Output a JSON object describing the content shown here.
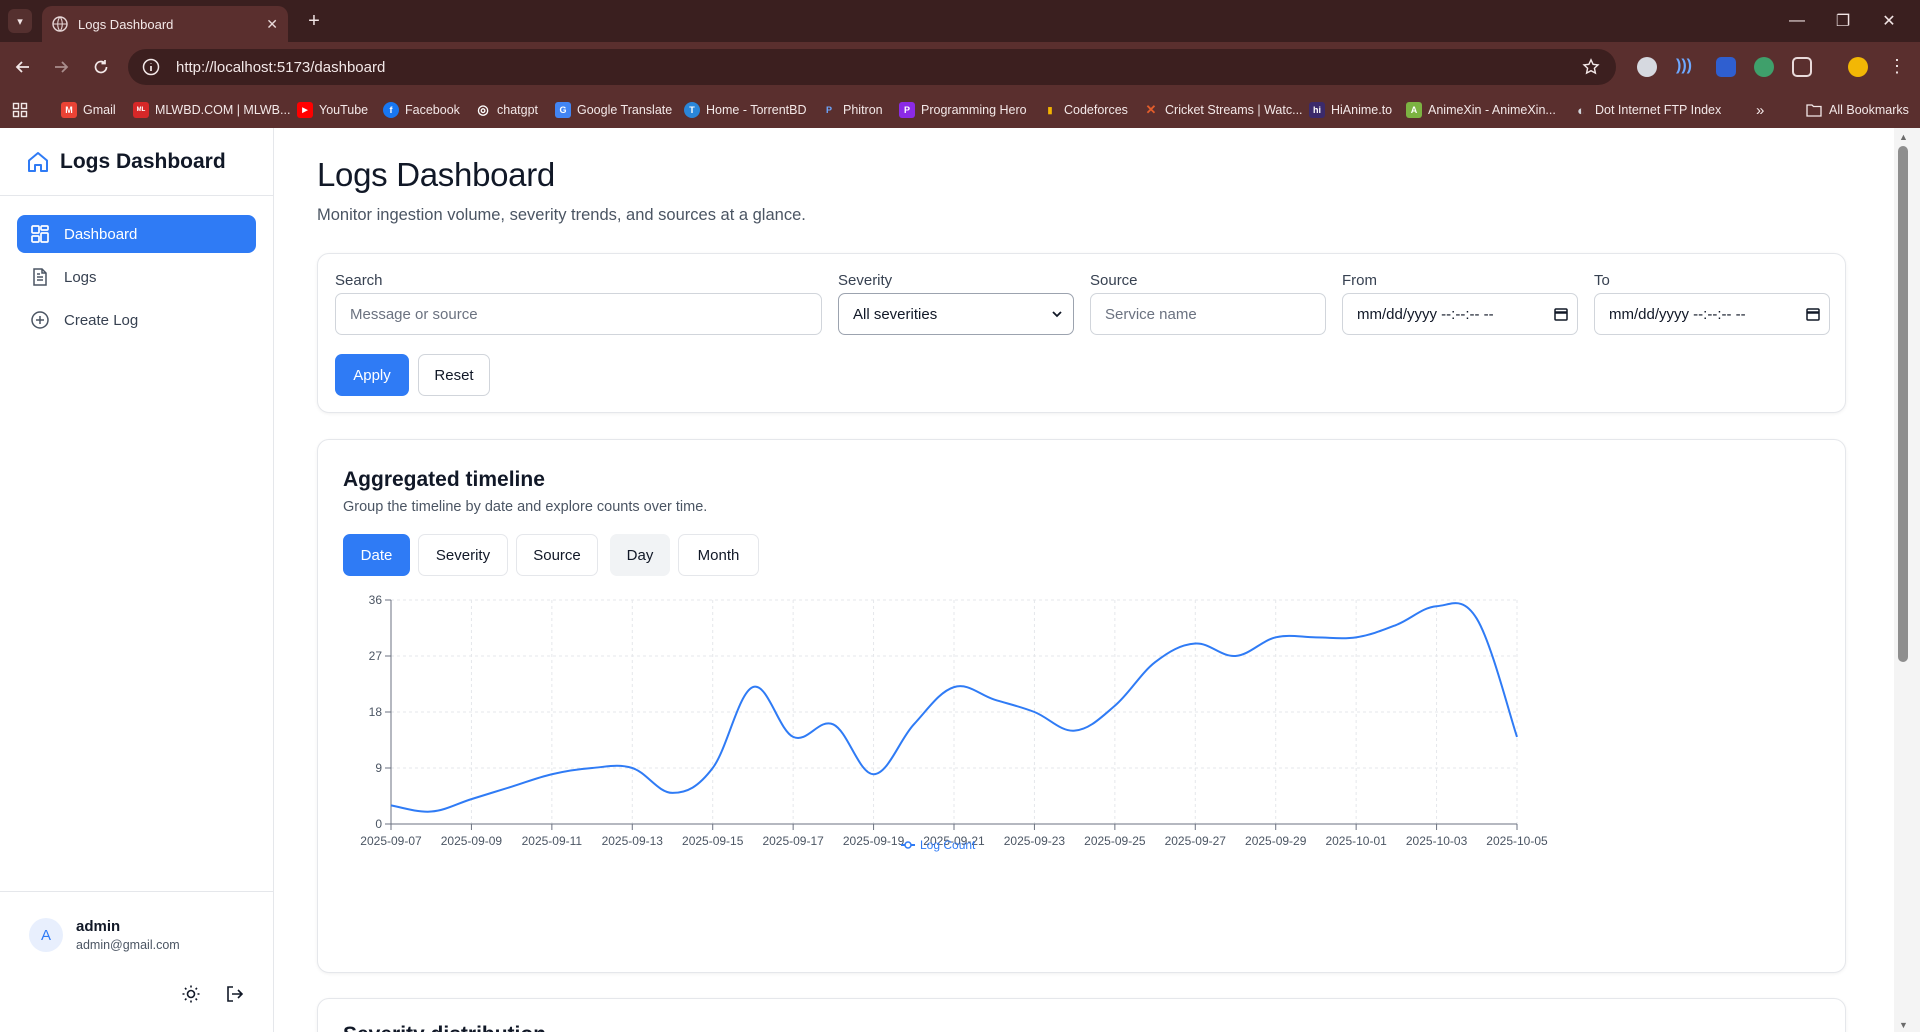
{
  "browser": {
    "tab_title": "Logs Dashboard",
    "url": "http://localhost:5173/dashboard",
    "bookmarks": [
      {
        "label": "Gmail",
        "color": "#ea4335",
        "glyph": "M"
      },
      {
        "label": "MLWBD.COM | MLWB...",
        "color": "#d62828",
        "glyph": "ML"
      },
      {
        "label": "YouTube",
        "color": "#ff0000",
        "glyph": "▶"
      },
      {
        "label": "Facebook",
        "color": "#1877f2",
        "glyph": "f"
      },
      {
        "label": "chatgpt",
        "color": "#6b7280",
        "glyph": "◎"
      },
      {
        "label": "Google Translate",
        "color": "#4285f4",
        "glyph": "G"
      },
      {
        "label": "Home - TorrentBD",
        "color": "#2a86d9",
        "glyph": "T"
      },
      {
        "label": "Phitron",
        "color": "#3b82f6",
        "glyph": "P"
      },
      {
        "label": "Programming Hero",
        "color": "#8b2ae6",
        "glyph": "P"
      },
      {
        "label": "Codeforces",
        "color": "#f4b400",
        "glyph": "▮"
      },
      {
        "label": "Cricket Streams | Watc...",
        "color": "#e35d2b",
        "glyph": "✕"
      },
      {
        "label": "HiAnime.to",
        "color": "#3b2a6b",
        "glyph": "hi"
      },
      {
        "label": "AnimeXin - AnimeXin...",
        "color": "#7cb342",
        "glyph": "A"
      },
      {
        "label": "Dot Internet FTP Index",
        "color": "#9ca3af",
        "glyph": "◐"
      }
    ],
    "all_bookmarks": "All Bookmarks"
  },
  "sidebar": {
    "brand": "Logs Dashboard",
    "items": [
      {
        "label": "Dashboard",
        "icon": "grid-icon",
        "active": true
      },
      {
        "label": "Logs",
        "icon": "document-icon",
        "active": false
      },
      {
        "label": "Create Log",
        "icon": "plus-circle-icon",
        "active": false
      }
    ],
    "user": {
      "initial": "A",
      "name": "admin",
      "email": "admin@gmail.com"
    }
  },
  "page": {
    "title": "Logs Dashboard",
    "subtitle": "Monitor ingestion volume, severity trends, and sources at a glance."
  },
  "filters": {
    "search_label": "Search",
    "search_placeholder": "Message or source",
    "severity_label": "Severity",
    "severity_value": "All severities",
    "source_label": "Source",
    "source_placeholder": "Service name",
    "from_label": "From",
    "from_value": "mm/dd/yyyy --:--:-- --",
    "to_label": "To",
    "to_value": "mm/dd/yyyy --:--:-- --",
    "apply": "Apply",
    "reset": "Reset"
  },
  "timeline": {
    "title": "Aggregated timeline",
    "subtitle": "Group the timeline by date and explore counts over time.",
    "group_buttons": [
      "Date",
      "Severity",
      "Source"
    ],
    "interval_buttons": [
      "Day",
      "Month"
    ],
    "active_group": "Date",
    "active_interval": "Day"
  },
  "chart_data": {
    "type": "line",
    "x": [
      "2025-09-07",
      "2025-09-08",
      "2025-09-09",
      "2025-09-10",
      "2025-09-11",
      "2025-09-12",
      "2025-09-13",
      "2025-09-14",
      "2025-09-15",
      "2025-09-16",
      "2025-09-17",
      "2025-09-18",
      "2025-09-19",
      "2025-09-20",
      "2025-09-21",
      "2025-09-22",
      "2025-09-23",
      "2025-09-24",
      "2025-09-25",
      "2025-09-26",
      "2025-09-27",
      "2025-09-28",
      "2025-09-29",
      "2025-09-30",
      "2025-10-01",
      "2025-10-02",
      "2025-10-03",
      "2025-10-04",
      "2025-10-05"
    ],
    "x_tick_labels": [
      "2025-09-07",
      "2025-09-09",
      "2025-09-11",
      "2025-09-13",
      "2025-09-15",
      "2025-09-17",
      "2025-09-19",
      "2025-09-21",
      "2025-09-23",
      "2025-09-25",
      "2025-09-27",
      "2025-09-29",
      "2025-10-01",
      "2025-10-03",
      "2025-10-05"
    ],
    "series": [
      {
        "name": "Log Count",
        "color": "#2f7bf5",
        "values": [
          3,
          2,
          4,
          6,
          8,
          9,
          9,
          5,
          9,
          22,
          14,
          16,
          8,
          16,
          22,
          20,
          18,
          15,
          19,
          26,
          29,
          27,
          30,
          30,
          30,
          32,
          35,
          33,
          14
        ]
      }
    ],
    "ylim": [
      0,
      36
    ],
    "y_ticks": [
      0,
      9,
      18,
      27,
      36
    ],
    "grid": true,
    "legend": "bottom-center",
    "xlabel": "",
    "ylabel": "",
    "title": ""
  },
  "next_section": {
    "title": "Severity distribution"
  }
}
